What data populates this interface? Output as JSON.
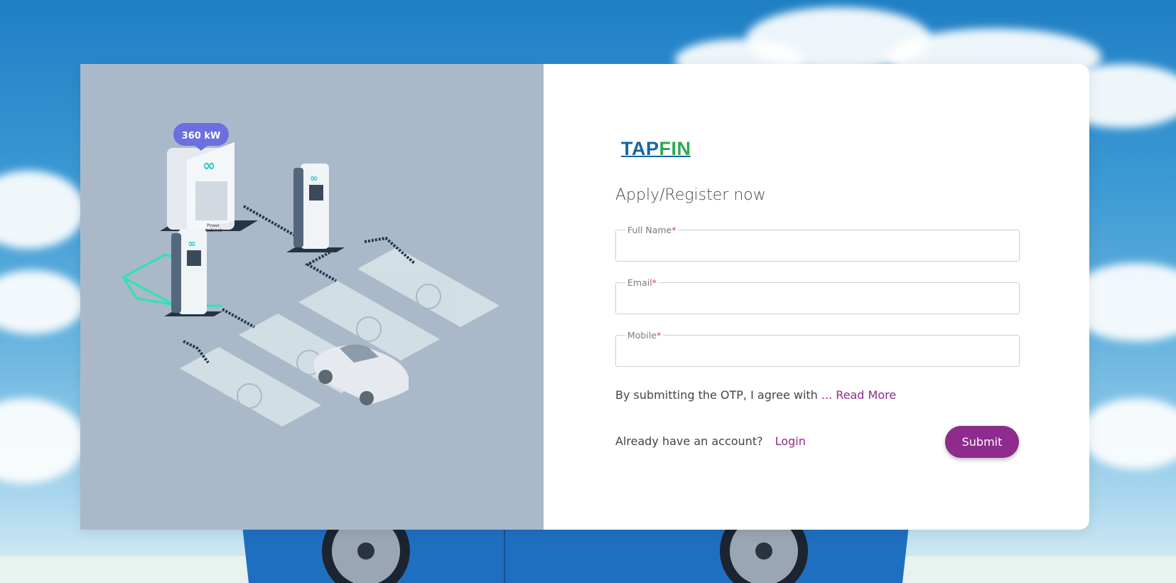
{
  "illustration": {
    "power_badge": "360 kW",
    "cabinet_label_line1": "Power",
    "cabinet_label_line2": "Cabinet"
  },
  "brand": {
    "logo_part1": "TAP",
    "logo_part2": "FIN",
    "color_primary": "#1565a6",
    "color_secondary": "#2fa84f"
  },
  "form": {
    "title": "Apply/Register now",
    "fields": [
      {
        "label": "Full Name",
        "required_mark": "*",
        "value": ""
      },
      {
        "label": "Email",
        "required_mark": "*",
        "value": ""
      },
      {
        "label": "Mobile",
        "required_mark": "*",
        "value": ""
      }
    ],
    "consent_text": "By submitting the OTP, I agree with",
    "read_more": "... Read More",
    "account_text": "Already have an account?",
    "login_label": "Login",
    "submit_label": "Submit",
    "accent_color": "#8e2b8c"
  }
}
